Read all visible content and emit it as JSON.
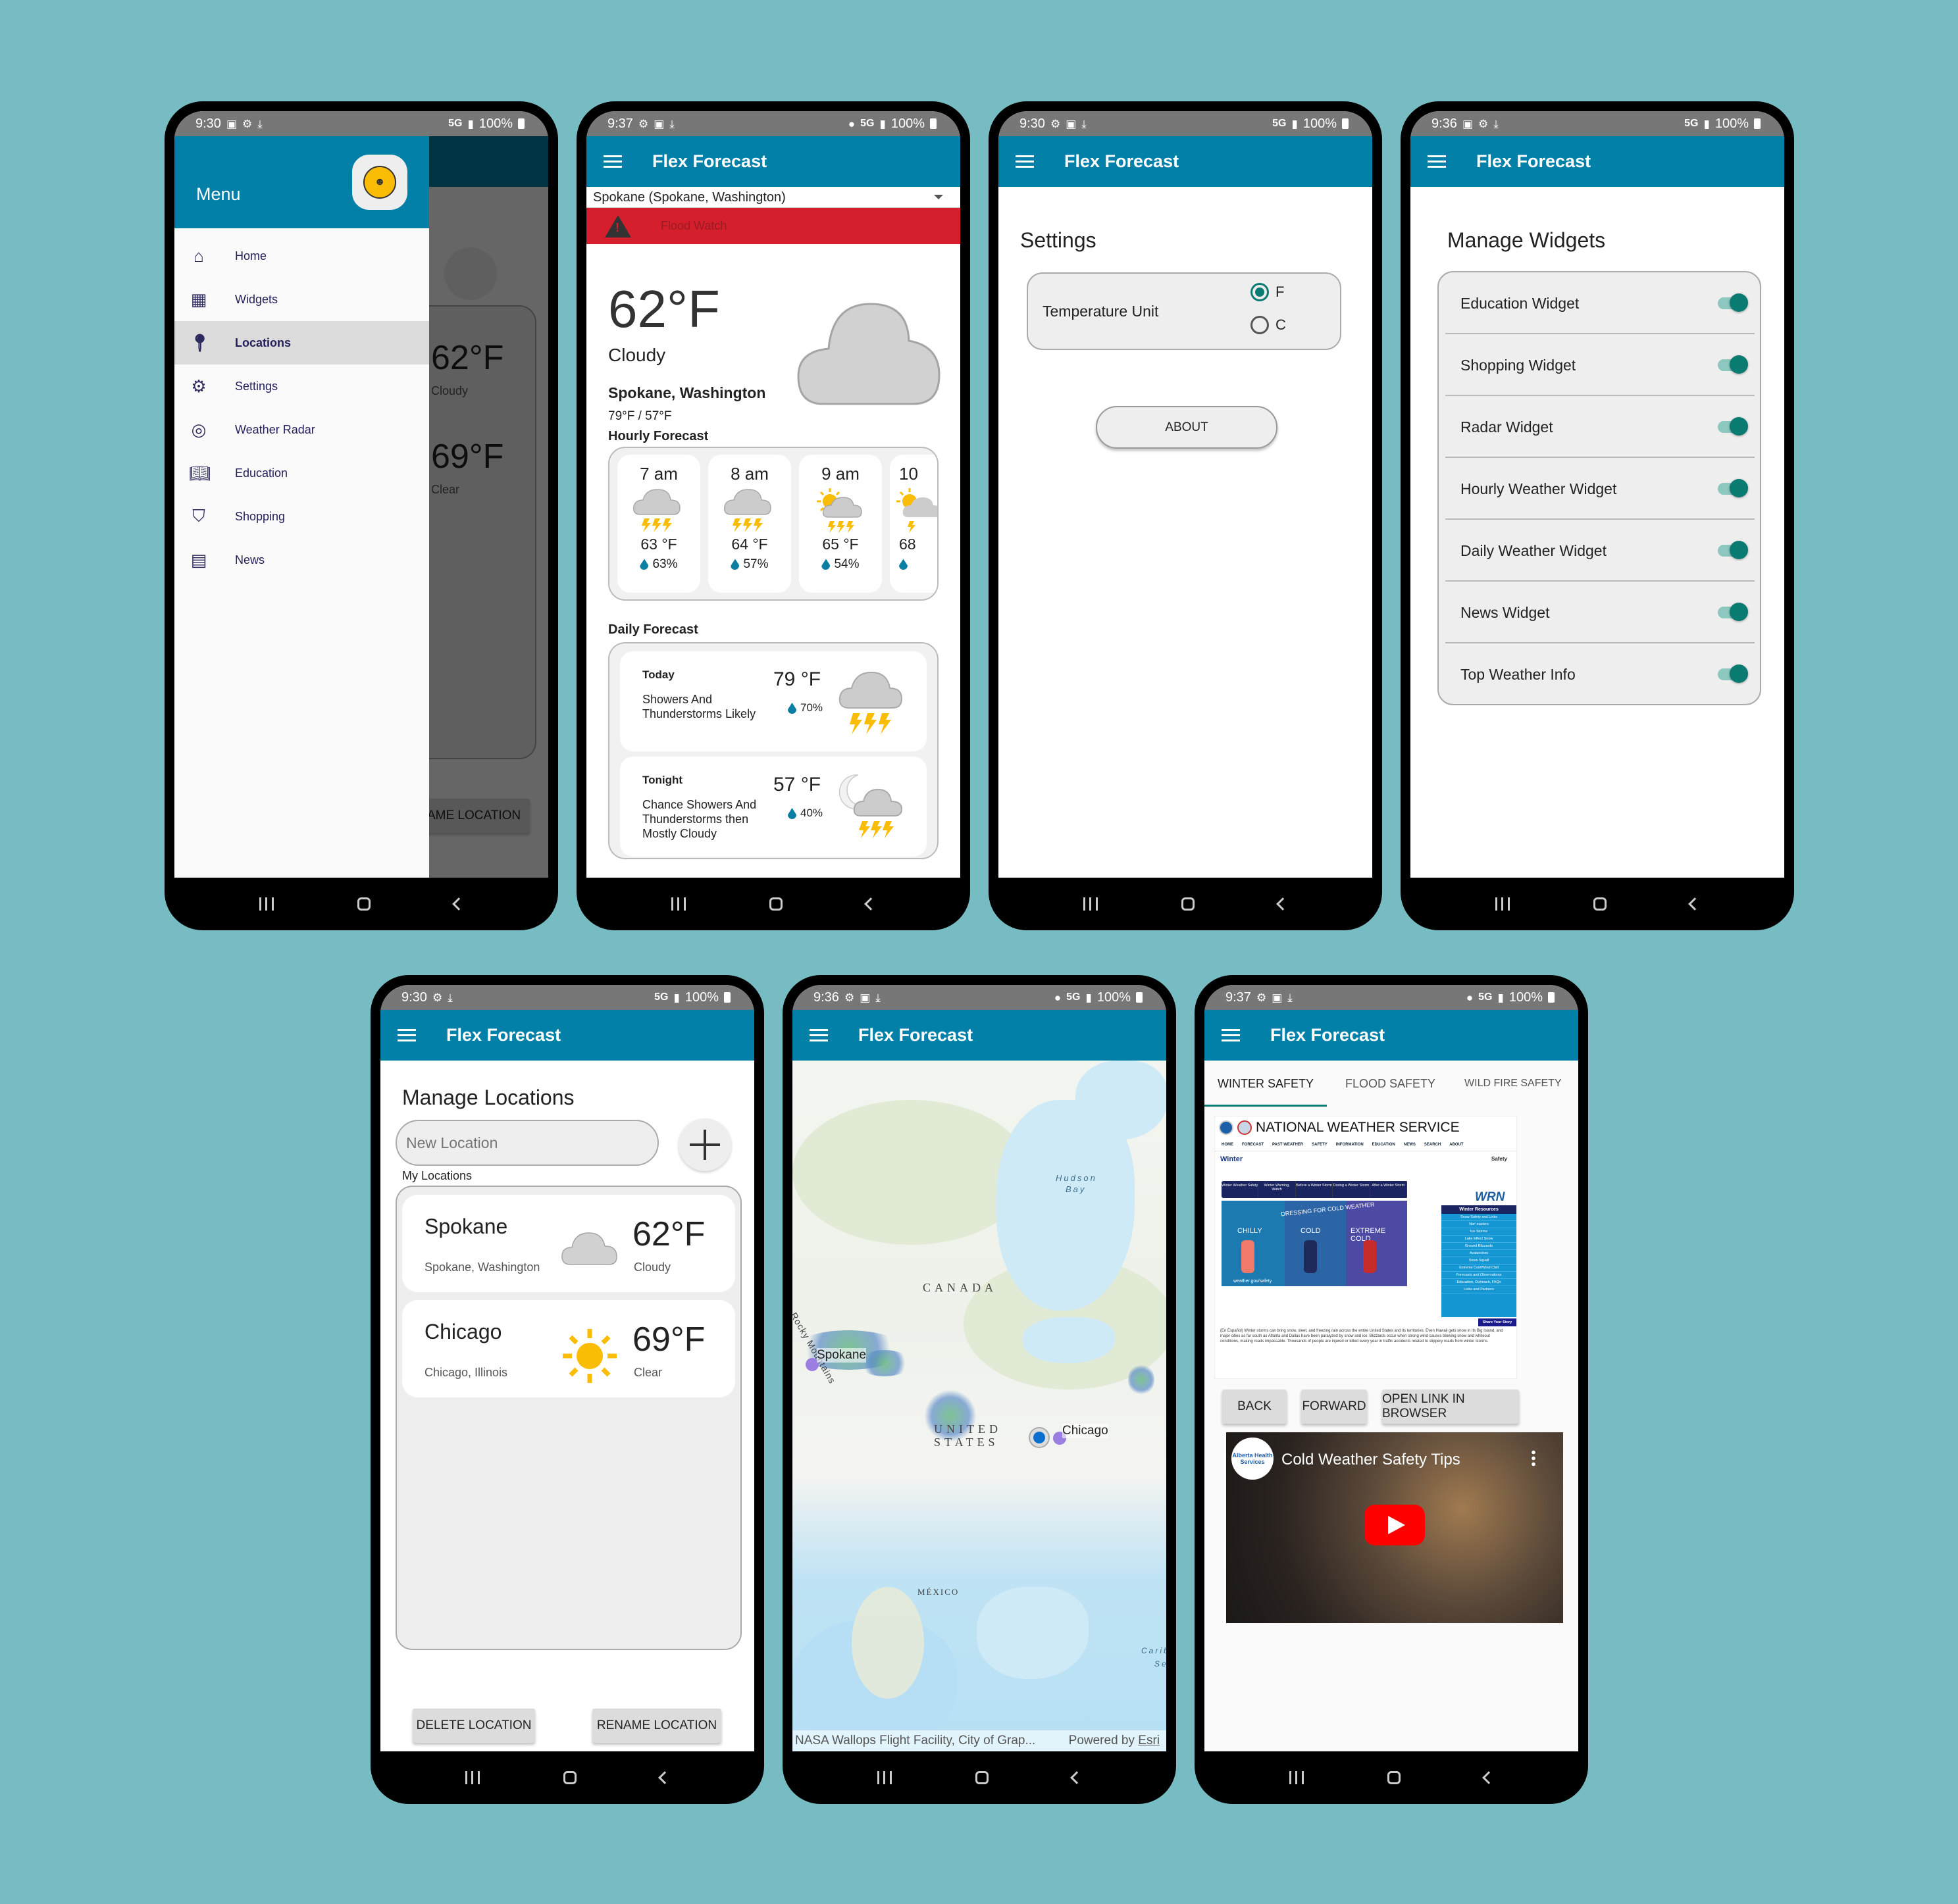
{
  "app": {
    "title": "Flex Forecast",
    "brand_color": "#0280a8",
    "accent_color": "#0a7b70",
    "alert_color": "#d61f2c"
  },
  "screens": {
    "menu": {
      "status": {
        "time": "9:30",
        "network": "5G",
        "battery": "100%"
      },
      "drawer_title": "Menu",
      "items": [
        {
          "icon": "home-icon",
          "glyph": "⌂",
          "label": "Home"
        },
        {
          "icon": "widgets-icon",
          "glyph": "▦",
          "label": "Widgets"
        },
        {
          "icon": "location-pin-icon",
          "glyph": "⬤",
          "label": "Locations",
          "active": true
        },
        {
          "icon": "settings-gear-icon",
          "glyph": "⚙",
          "label": "Settings"
        },
        {
          "icon": "radar-icon",
          "glyph": "◎",
          "label": "Weather Radar"
        },
        {
          "icon": "book-icon",
          "glyph": "▯",
          "label": "Education"
        },
        {
          "icon": "basket-icon",
          "glyph": "⛉",
          "label": "Shopping"
        },
        {
          "icon": "news-icon",
          "glyph": "▤",
          "label": "News"
        }
      ],
      "behind": {
        "temp1": "62°F",
        "cond1": "Cloudy",
        "temp2": "69°F",
        "cond2": "Clear",
        "button": "RENAME LOCATION"
      }
    },
    "home": {
      "status": {
        "time": "9:37",
        "network": "5G",
        "battery": "100%"
      },
      "location_select": "Spokane (Spokane, Washington)",
      "alert": "Flood Watch",
      "current": {
        "temp": "62°F",
        "condition": "Cloudy",
        "location": "Spokane, Washington",
        "high_low": "79°F / 57°F"
      },
      "hourly_label": "Hourly Forecast",
      "hourly": [
        {
          "time": "7 am",
          "temp": "63 °F",
          "precip": "63%",
          "icon": "thunderstorm"
        },
        {
          "time": "8 am",
          "temp": "64 °F",
          "precip": "57%",
          "icon": "thunderstorm"
        },
        {
          "time": "9 am",
          "temp": "65 °F",
          "precip": "54%",
          "icon": "partly-sunny-thunderstorm"
        },
        {
          "time": "10",
          "temp": "68",
          "precip": "",
          "icon": "partly-sunny-thunderstorm"
        }
      ],
      "daily_label": "Daily Forecast",
      "daily": [
        {
          "name": "Today",
          "desc": "Showers And Thunderstorms Likely",
          "temp": "79 °F",
          "precip": "70%",
          "icon": "thunderstorm"
        },
        {
          "name": "Tonight",
          "desc": "Chance Showers And Thunderstorms then Mostly Cloudy",
          "temp": "57 °F",
          "precip": "40%",
          "icon": "night-thunderstorm"
        }
      ]
    },
    "settings": {
      "status": {
        "time": "9:30",
        "network": "5G",
        "battery": "100%"
      },
      "heading": "Settings",
      "temp_unit_label": "Temperature Unit",
      "options": [
        {
          "label": "F",
          "selected": true
        },
        {
          "label": "C",
          "selected": false
        }
      ],
      "about_button": "ABOUT"
    },
    "widgets": {
      "status": {
        "time": "9:36",
        "network": "5G",
        "battery": "100%"
      },
      "heading": "Manage Widgets",
      "items": [
        {
          "label": "Education Widget",
          "enabled": true
        },
        {
          "label": "Shopping Widget",
          "enabled": true
        },
        {
          "label": "Radar Widget",
          "enabled": true
        },
        {
          "label": "Hourly Weather Widget",
          "enabled": true
        },
        {
          "label": "Daily Weather Widget",
          "enabled": true
        },
        {
          "label": "News Widget",
          "enabled": true
        },
        {
          "label": "Top Weather Info",
          "enabled": true
        }
      ]
    },
    "locations": {
      "status": {
        "time": "9:30",
        "network": "5G",
        "battery": "100%"
      },
      "heading": "Manage Locations",
      "input_placeholder": "New Location",
      "list_label": "My Locations",
      "items": [
        {
          "name": "Spokane",
          "full": "Spokane, Washington",
          "temp": "62°F",
          "condition": "Cloudy",
          "icon": "cloud"
        },
        {
          "name": "Chicago",
          "full": "Chicago, Illinois",
          "temp": "69°F",
          "condition": "Clear",
          "icon": "sun"
        }
      ],
      "delete_button": "DELETE LOCATION",
      "rename_button": "RENAME LOCATION"
    },
    "radar": {
      "status": {
        "time": "9:36",
        "network": "5G",
        "battery": "100%"
      },
      "labels": {
        "canada": "CANADA",
        "us1": "UNITED",
        "us2": "STATES",
        "mexico": "MÉXICO",
        "hudson1": "Hudson",
        "hudson2": "Bay",
        "rocky": "Rocky Mountains",
        "carib1": "Carib",
        "carib2": "Se"
      },
      "markers": [
        {
          "label": "Spokane"
        },
        {
          "label": "Chicago"
        }
      ],
      "attribution": "NASA Wallops Flight Facility, City of Grap...",
      "powered_by": "Powered by",
      "esri": "Esri"
    },
    "education": {
      "status": {
        "time": "9:37",
        "network": "5G",
        "battery": "100%"
      },
      "tabs": [
        {
          "label": "WINTER SAFETY",
          "active": true
        },
        {
          "label": "FLOOD SAFETY"
        },
        {
          "label": "WILD FIRE SAFETY"
        }
      ],
      "web": {
        "site_title": "NATIONAL WEATHER SERVICE",
        "nav": [
          "HOME",
          "FORECAST",
          "PAST WEATHER",
          "SAFETY",
          "INFORMATION",
          "EDUCATION",
          "NEWS",
          "SEARCH",
          "ABOUT"
        ],
        "page_title": "Winter",
        "section": "Safety",
        "subtabs": [
          "Winter Weather Safety",
          "Winter Warning, Watch",
          "Before a Winter Storm",
          "During a Winter Storm",
          "After a Winter Storm"
        ],
        "infographic": {
          "title": "DRESSING FOR COLD WEATHER",
          "cols": [
            "CHILLY",
            "COLD",
            "EXTREME COLD"
          ],
          "footer": "weather.gov/safety"
        },
        "resources_title": "Winter Resources",
        "resources": [
          "Snow Safety and Links",
          "Nor' easters",
          "Ice Storms",
          "Lake Effect Snow",
          "Ground Blizzards",
          "Avalanches",
          "Snow Squall",
          "Extreme Cold/Wind Chill",
          "Forecasts and Observations",
          "Education, Outreach, FAQs",
          "Links and Partners"
        ],
        "share": "Share Your Story",
        "paragraph": "(En Español) Winter storms can bring snow, sleet, and freezing rain across the entire United States and its territories. Even Hawaii gets snow in its Big Island, and major cities as far south as Atlanta and Dallas have been paralyzed by snow and ice. Blizzards occur when strong wind causes blowing snow and whiteout conditions, making roads impassable. Thousands of people are injured or killed every year in traffic accidents related to slippery roads from winter storms."
      },
      "buttons": {
        "back": "BACK",
        "forward": "FORWARD",
        "open": "OPEN LINK IN BROWSER"
      },
      "video": {
        "title": "Cold Weather Safety Tips",
        "channel": "Alberta Health Services"
      }
    }
  }
}
